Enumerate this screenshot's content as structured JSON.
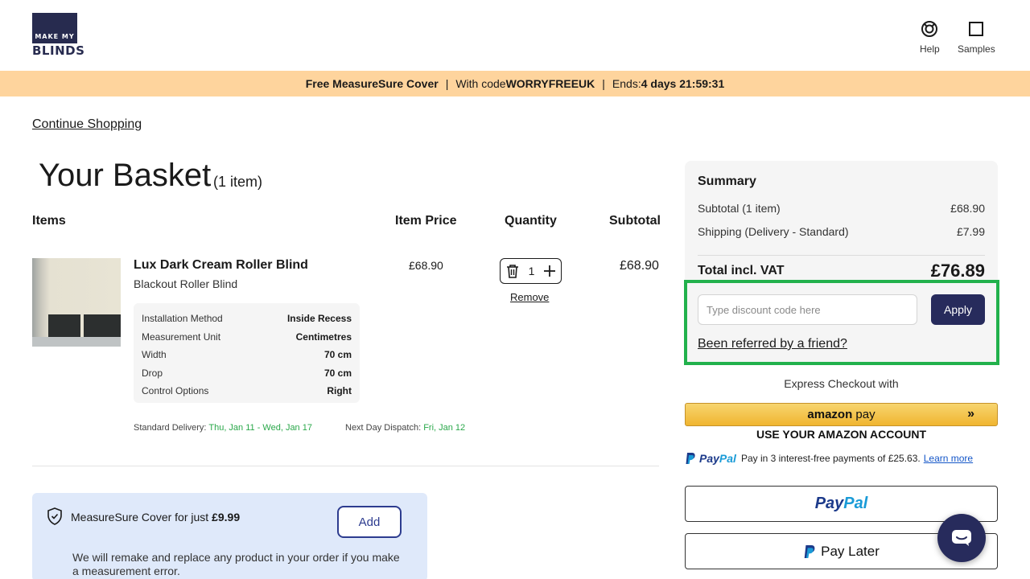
{
  "brand": {
    "logo_top": "MAKE MY",
    "logo_bottom": "BLINDS"
  },
  "header": {
    "help_label": "Help",
    "samples_label": "Samples"
  },
  "promo": {
    "part1": "Free MeasureSure Cover",
    "part2_prefix": "With code ",
    "code": "WORRYFREEUK",
    "part3_prefix": "Ends: ",
    "countdown": "4 days 21:59:31",
    "background": "#fed49d"
  },
  "nav": {
    "continue_label": "Continue Shopping"
  },
  "basket": {
    "title": "Your Basket",
    "count": "(1 item)",
    "columns": {
      "items": "Items",
      "item_price": "Item Price",
      "quantity": "Quantity",
      "subtotal": "Subtotal"
    },
    "item": {
      "name": "Lux Dark Cream Roller Blind",
      "type": "Blackout Roller Blind",
      "specs": [
        {
          "label": "Installation Method",
          "value": "Inside Recess"
        },
        {
          "label": "Measurement Unit",
          "value": "Centimetres"
        },
        {
          "label": "Width",
          "value": "70 cm"
        },
        {
          "label": "Drop",
          "value": "70 cm"
        },
        {
          "label": "Control Options",
          "value": "Right"
        }
      ],
      "price": "£68.90",
      "quantity": "1",
      "remove_label": "Remove",
      "subtotal": "£68.90",
      "delivery_label": "Standard Delivery: ",
      "delivery_value": "Thu, Jan 11 - Wed, Jan 17",
      "dispatch_label": "Next Day Dispatch: ",
      "dispatch_value": "Fri, Jan 12"
    }
  },
  "cover": {
    "title_prefix": "MeasureSure Cover for just ",
    "price": "£9.99",
    "add_label": "Add",
    "description": "We will remake and replace any product in your order if you make a measurement error."
  },
  "summary": {
    "title": "Summary",
    "subtotal_label": "Subtotal (1 item)",
    "subtotal_value": "£68.90",
    "shipping_label": "Shipping (Delivery - Standard)",
    "shipping_value": "£7.99",
    "total_label": "Total incl. VAT",
    "total_value": "£76.89",
    "discount_placeholder": "Type discount code here",
    "apply_label": "Apply",
    "referred_label": "Been referred by a friend?"
  },
  "checkout": {
    "express_label": "Express Checkout with",
    "amazon_brand": "amazon",
    "amazon_pay": "pay",
    "amazon_arrows": "»",
    "amazon_sub": "USE YOUR AMAZON ACCOUNT",
    "paypal_pay": "Pay",
    "paypal_pal": "Pal",
    "paypal_offer": "Pay in 3 interest-free payments of £25.63.",
    "learn_more": "Learn more",
    "paylater_label": "Pay Later"
  },
  "colors": {
    "accent": "#272b5c",
    "highlight": "#22b14c",
    "green_text": "#2aa84a",
    "cover_bg": "#dfe9fa"
  }
}
